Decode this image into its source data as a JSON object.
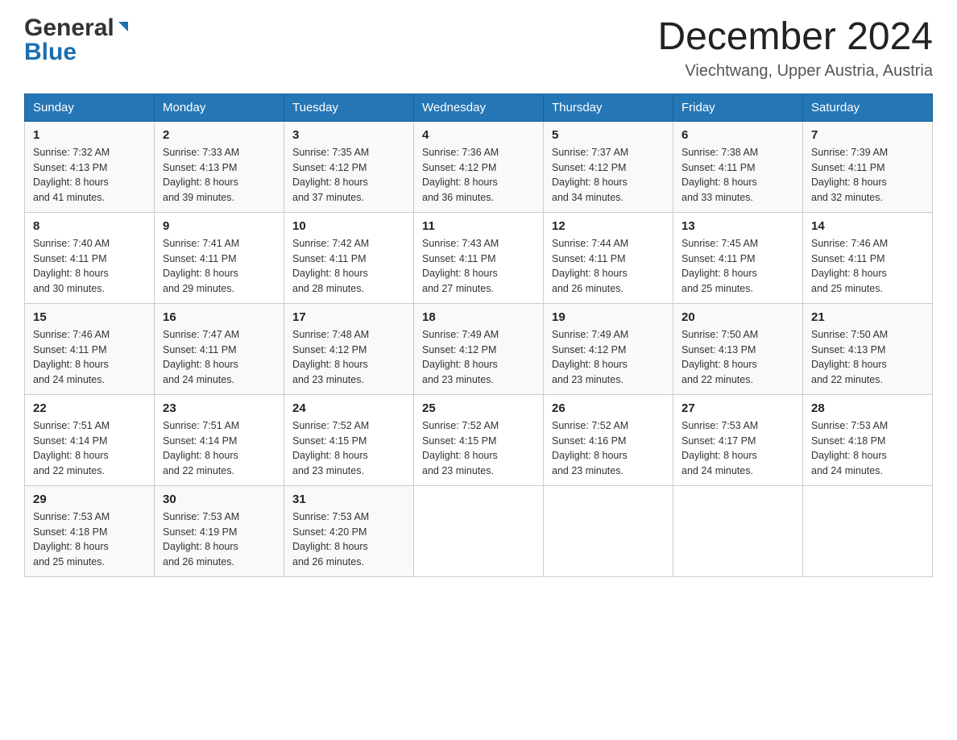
{
  "header": {
    "logo_general": "General",
    "logo_blue": "Blue",
    "month_title": "December 2024",
    "location": "Viechtwang, Upper Austria, Austria"
  },
  "weekdays": [
    "Sunday",
    "Monday",
    "Tuesday",
    "Wednesday",
    "Thursday",
    "Friday",
    "Saturday"
  ],
  "weeks": [
    [
      {
        "day": "1",
        "sunrise": "7:32 AM",
        "sunset": "4:13 PM",
        "daylight": "8 hours and 41 minutes."
      },
      {
        "day": "2",
        "sunrise": "7:33 AM",
        "sunset": "4:13 PM",
        "daylight": "8 hours and 39 minutes."
      },
      {
        "day": "3",
        "sunrise": "7:35 AM",
        "sunset": "4:12 PM",
        "daylight": "8 hours and 37 minutes."
      },
      {
        "day": "4",
        "sunrise": "7:36 AM",
        "sunset": "4:12 PM",
        "daylight": "8 hours and 36 minutes."
      },
      {
        "day": "5",
        "sunrise": "7:37 AM",
        "sunset": "4:12 PM",
        "daylight": "8 hours and 34 minutes."
      },
      {
        "day": "6",
        "sunrise": "7:38 AM",
        "sunset": "4:11 PM",
        "daylight": "8 hours and 33 minutes."
      },
      {
        "day": "7",
        "sunrise": "7:39 AM",
        "sunset": "4:11 PM",
        "daylight": "8 hours and 32 minutes."
      }
    ],
    [
      {
        "day": "8",
        "sunrise": "7:40 AM",
        "sunset": "4:11 PM",
        "daylight": "8 hours and 30 minutes."
      },
      {
        "day": "9",
        "sunrise": "7:41 AM",
        "sunset": "4:11 PM",
        "daylight": "8 hours and 29 minutes."
      },
      {
        "day": "10",
        "sunrise": "7:42 AM",
        "sunset": "4:11 PM",
        "daylight": "8 hours and 28 minutes."
      },
      {
        "day": "11",
        "sunrise": "7:43 AM",
        "sunset": "4:11 PM",
        "daylight": "8 hours and 27 minutes."
      },
      {
        "day": "12",
        "sunrise": "7:44 AM",
        "sunset": "4:11 PM",
        "daylight": "8 hours and 26 minutes."
      },
      {
        "day": "13",
        "sunrise": "7:45 AM",
        "sunset": "4:11 PM",
        "daylight": "8 hours and 25 minutes."
      },
      {
        "day": "14",
        "sunrise": "7:46 AM",
        "sunset": "4:11 PM",
        "daylight": "8 hours and 25 minutes."
      }
    ],
    [
      {
        "day": "15",
        "sunrise": "7:46 AM",
        "sunset": "4:11 PM",
        "daylight": "8 hours and 24 minutes."
      },
      {
        "day": "16",
        "sunrise": "7:47 AM",
        "sunset": "4:11 PM",
        "daylight": "8 hours and 24 minutes."
      },
      {
        "day": "17",
        "sunrise": "7:48 AM",
        "sunset": "4:12 PM",
        "daylight": "8 hours and 23 minutes."
      },
      {
        "day": "18",
        "sunrise": "7:49 AM",
        "sunset": "4:12 PM",
        "daylight": "8 hours and 23 minutes."
      },
      {
        "day": "19",
        "sunrise": "7:49 AM",
        "sunset": "4:12 PM",
        "daylight": "8 hours and 23 minutes."
      },
      {
        "day": "20",
        "sunrise": "7:50 AM",
        "sunset": "4:13 PM",
        "daylight": "8 hours and 22 minutes."
      },
      {
        "day": "21",
        "sunrise": "7:50 AM",
        "sunset": "4:13 PM",
        "daylight": "8 hours and 22 minutes."
      }
    ],
    [
      {
        "day": "22",
        "sunrise": "7:51 AM",
        "sunset": "4:14 PM",
        "daylight": "8 hours and 22 minutes."
      },
      {
        "day": "23",
        "sunrise": "7:51 AM",
        "sunset": "4:14 PM",
        "daylight": "8 hours and 22 minutes."
      },
      {
        "day": "24",
        "sunrise": "7:52 AM",
        "sunset": "4:15 PM",
        "daylight": "8 hours and 23 minutes."
      },
      {
        "day": "25",
        "sunrise": "7:52 AM",
        "sunset": "4:15 PM",
        "daylight": "8 hours and 23 minutes."
      },
      {
        "day": "26",
        "sunrise": "7:52 AM",
        "sunset": "4:16 PM",
        "daylight": "8 hours and 23 minutes."
      },
      {
        "day": "27",
        "sunrise": "7:53 AM",
        "sunset": "4:17 PM",
        "daylight": "8 hours and 24 minutes."
      },
      {
        "day": "28",
        "sunrise": "7:53 AM",
        "sunset": "4:18 PM",
        "daylight": "8 hours and 24 minutes."
      }
    ],
    [
      {
        "day": "29",
        "sunrise": "7:53 AM",
        "sunset": "4:18 PM",
        "daylight": "8 hours and 25 minutes."
      },
      {
        "day": "30",
        "sunrise": "7:53 AM",
        "sunset": "4:19 PM",
        "daylight": "8 hours and 26 minutes."
      },
      {
        "day": "31",
        "sunrise": "7:53 AM",
        "sunset": "4:20 PM",
        "daylight": "8 hours and 26 minutes."
      },
      null,
      null,
      null,
      null
    ]
  ],
  "labels": {
    "sunrise": "Sunrise:",
    "sunset": "Sunset:",
    "daylight": "Daylight:"
  }
}
